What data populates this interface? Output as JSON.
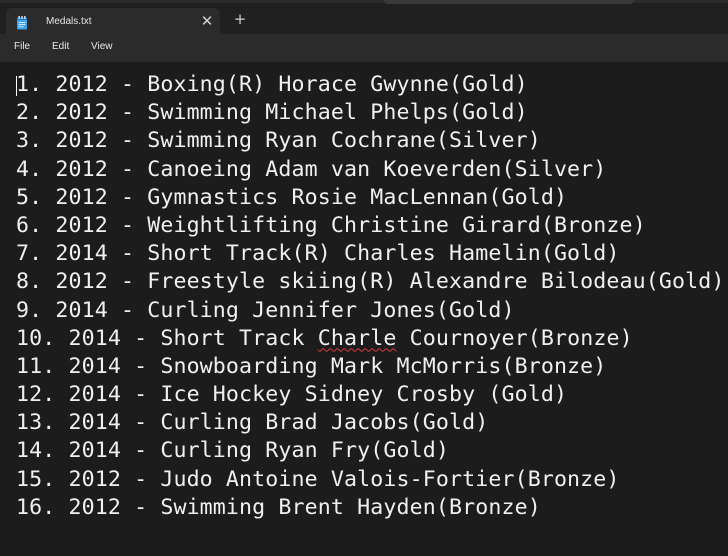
{
  "tab": {
    "title": "Medals.txt",
    "icon": "notepad-icon",
    "close_glyph": "✕",
    "new_tab_glyph": "+"
  },
  "menu": {
    "file": "File",
    "edit": "Edit",
    "view": "View"
  },
  "editor": {
    "lines": [
      "1. 2012 - Boxing(R) Horace Gwynne(Gold)",
      "2. 2012 - Swimming Michael Phelps(Gold)",
      "3. 2012 - Swimming Ryan Cochrane(Silver)",
      "4. 2012 - Canoeing Adam van Koeverden(Silver)",
      "5. 2012 - Gymnastics Rosie MacLennan(Gold)",
      "6. 2012 - Weightlifting Christine Girard(Bronze)",
      "7. 2014 - Short Track(R) Charles Hamelin(Gold)",
      "8. 2012 - Freestyle skiing(R) Alexandre Bilodeau(Gold)",
      "9. 2014 - Curling Jennifer Jones(Gold)",
      "10. 2014 - Short Track Charle Cournoyer(Bronze)",
      "11. 2014 - Snowboarding Mark McMorris(Bronze)",
      "12. 2014 - Ice Hockey Sidney Crosby (Gold)",
      "13. 2014 - Curling Brad Jacobs(Gold)",
      "14. 2014 - Curling Ryan Fry(Gold)",
      "15. 2012 - Judo Antoine Valois-Fortier(Bronze)",
      "16. 2012 - Swimming Brent Hayden(Bronze)"
    ],
    "line10_parts": {
      "before": "10. 2014 - Short Track ",
      "misspelled": "Charle",
      "after": " Cournoyer(Bronze)"
    }
  }
}
